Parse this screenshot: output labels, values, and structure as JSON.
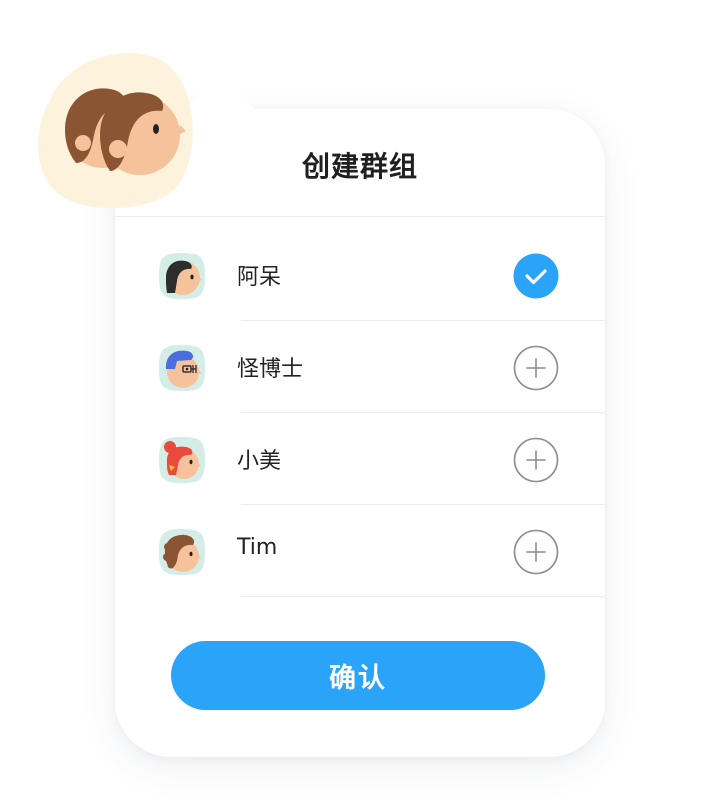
{
  "dialog": {
    "title": "创建群组",
    "confirm_label": "确认"
  },
  "contacts": [
    {
      "name": "阿呆",
      "status": "selected",
      "avatar_icon": "dark-hair-avatar-icon"
    },
    {
      "name": "怪博士",
      "status": "add",
      "avatar_icon": "blue-hair-glasses-avatar-icon"
    },
    {
      "name": "小美",
      "status": "add",
      "avatar_icon": "red-hair-avatar-icon"
    },
    {
      "name": "Tim",
      "status": "add",
      "avatar_icon": "brown-curly-hair-avatar-icon"
    }
  ],
  "colors": {
    "accent": "#2aa4f8",
    "avatar_bg": "#d4ede6",
    "badge_bg": "#fdf2db",
    "skin": "#f5c29b",
    "hair_brown": "#8b5534"
  }
}
